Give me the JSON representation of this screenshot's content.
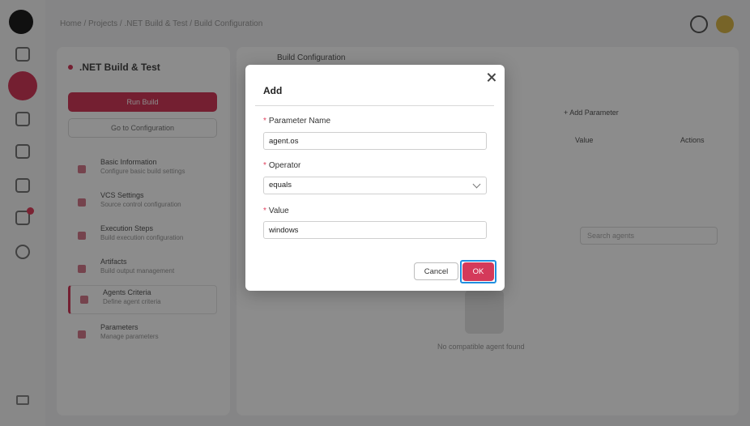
{
  "breadcrumb": "Home / Projects / .NET Build & Test / Build Configuration",
  "left_panel": {
    "title": ".NET Build & Test",
    "run_button": "Run Build",
    "config_button": "Go to Configuration",
    "items": [
      {
        "title": "Basic Information",
        "subtitle": "Configure basic build settings"
      },
      {
        "title": "VCS Settings",
        "subtitle": "Source control configuration"
      },
      {
        "title": "Execution Steps",
        "subtitle": "Build execution configuration"
      },
      {
        "title": "Artifacts",
        "subtitle": "Build output management"
      },
      {
        "title": "Agents Criteria",
        "subtitle": "Define agent criteria"
      },
      {
        "title": "Parameters",
        "subtitle": "Manage parameters"
      }
    ]
  },
  "main_panel": {
    "title": "Build Configuration",
    "add_parameter": "+ Add Parameter",
    "col_value": "Value",
    "col_actions": "Actions",
    "search_placeholder": "Search agents",
    "empty_text": "No compatible agent found"
  },
  "dialog": {
    "title": "Add",
    "fields": {
      "parameter_name": {
        "label": "Parameter Name",
        "value": "agent.os"
      },
      "operator": {
        "label": "Operator",
        "value": "equals"
      },
      "value": {
        "label": "Value",
        "value": "windows"
      }
    },
    "required_mark": "*",
    "cancel_label": "Cancel",
    "ok_label": "OK"
  },
  "colors": {
    "accent": "#d43a5a",
    "focus": "#1f8fe0"
  }
}
